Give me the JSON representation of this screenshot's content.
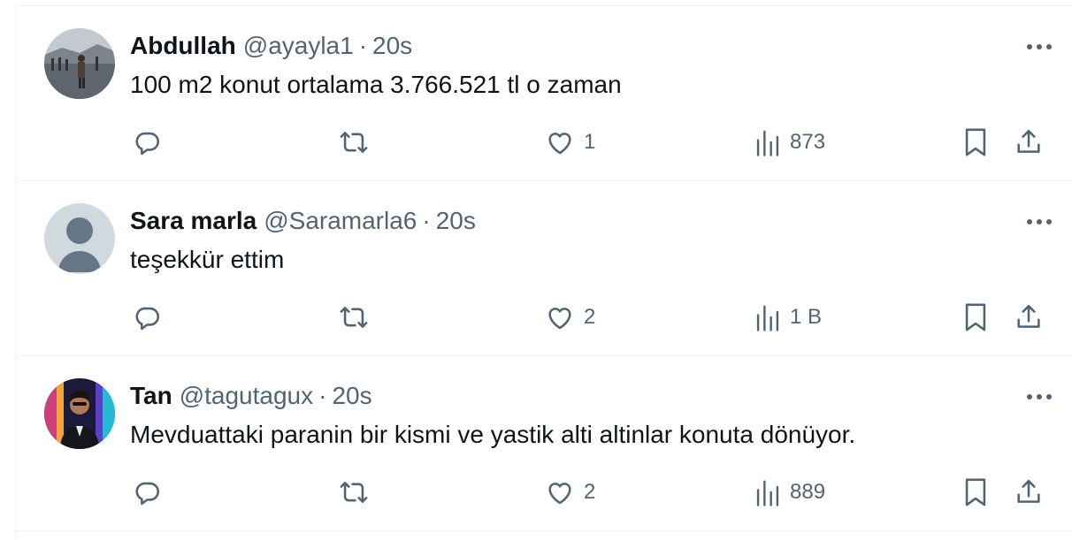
{
  "tweets": [
    {
      "name": "Abdullah",
      "handle": "@ayayla1",
      "separator": "·",
      "time": "20s",
      "text": "100 m2 konut ortalama 3.766.521 tl o zaman",
      "likes": "1",
      "views": "873",
      "avatar": "photo-avatar-street"
    },
    {
      "name": "Sara marla",
      "handle": "@Saramarla6",
      "separator": "·",
      "time": "20s",
      "text": "teşekkür ettim",
      "likes": "2",
      "views": "1 B",
      "avatar": "default-avatar"
    },
    {
      "name": "Tan",
      "handle": "@tagutagux",
      "separator": "·",
      "time": "20s",
      "text": "Mevduattaki paranin bir kismi ve yastik alti altinlar konuta dönüyor.",
      "likes": "2",
      "views": "889",
      "avatar": "photo-avatar-neon-man"
    }
  ],
  "icons": [
    "reply-icon",
    "repost-icon",
    "like-icon",
    "views-icon",
    "bookmark-icon",
    "share-icon",
    "more-icon"
  ],
  "colors": {
    "text": "#0f1419",
    "secondary": "#536471",
    "divider": "#eff3f4",
    "default_avatar_bg": "#cfd9de"
  }
}
